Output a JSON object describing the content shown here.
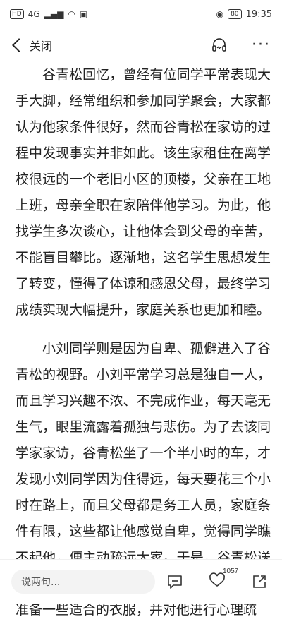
{
  "status_bar": {
    "hd": "HD",
    "signal": "4G",
    "battery": "80",
    "time": "19:35"
  },
  "nav": {
    "close_label": "关闭"
  },
  "article": {
    "paragraphs": [
      "谷青松回忆，曾经有位同学平常表现大手大脚，经常组织和参加同学聚会，大家都认为他家条件很好，然而谷青松在家访的过程中发现事实并非如此。该生家租住在离学校很远的一个老旧小区的顶楼，父亲在工地上班，母亲全职在家陪伴他学习。为此，他找学生多次谈心，让他体会到父母的辛苦，不能盲目攀比。逐渐地，这名学生思想发生了转变，懂得了体谅和感恩父母，最终学习成绩实现大幅提升，家庭关系也更加和睦。",
      "小刘同学则是因为自卑、孤僻进入了谷青松的视野。小刘平常学习总是独自一人，而且学习兴趣不浓、不完成作业，每天毫无生气，眼里流露着孤独与悲伤。为了去该同学家家访，谷青松坐了一个半小时的车，才发现小刘同学因为住得远，每天要花三个小时在路上，而且父母都是务工人员，家庭条件有限，这些都让他感觉自卑，觉得同学瞧不起他，便主动疏远大家。于是，谷青松送他学习资料，陪他跳绳、跑步，换季时为他准备一些适合的衣服，并对他进行心理疏"
    ]
  },
  "bottom_bar": {
    "comment_placeholder": "说两句...",
    "like_count": "1057"
  }
}
